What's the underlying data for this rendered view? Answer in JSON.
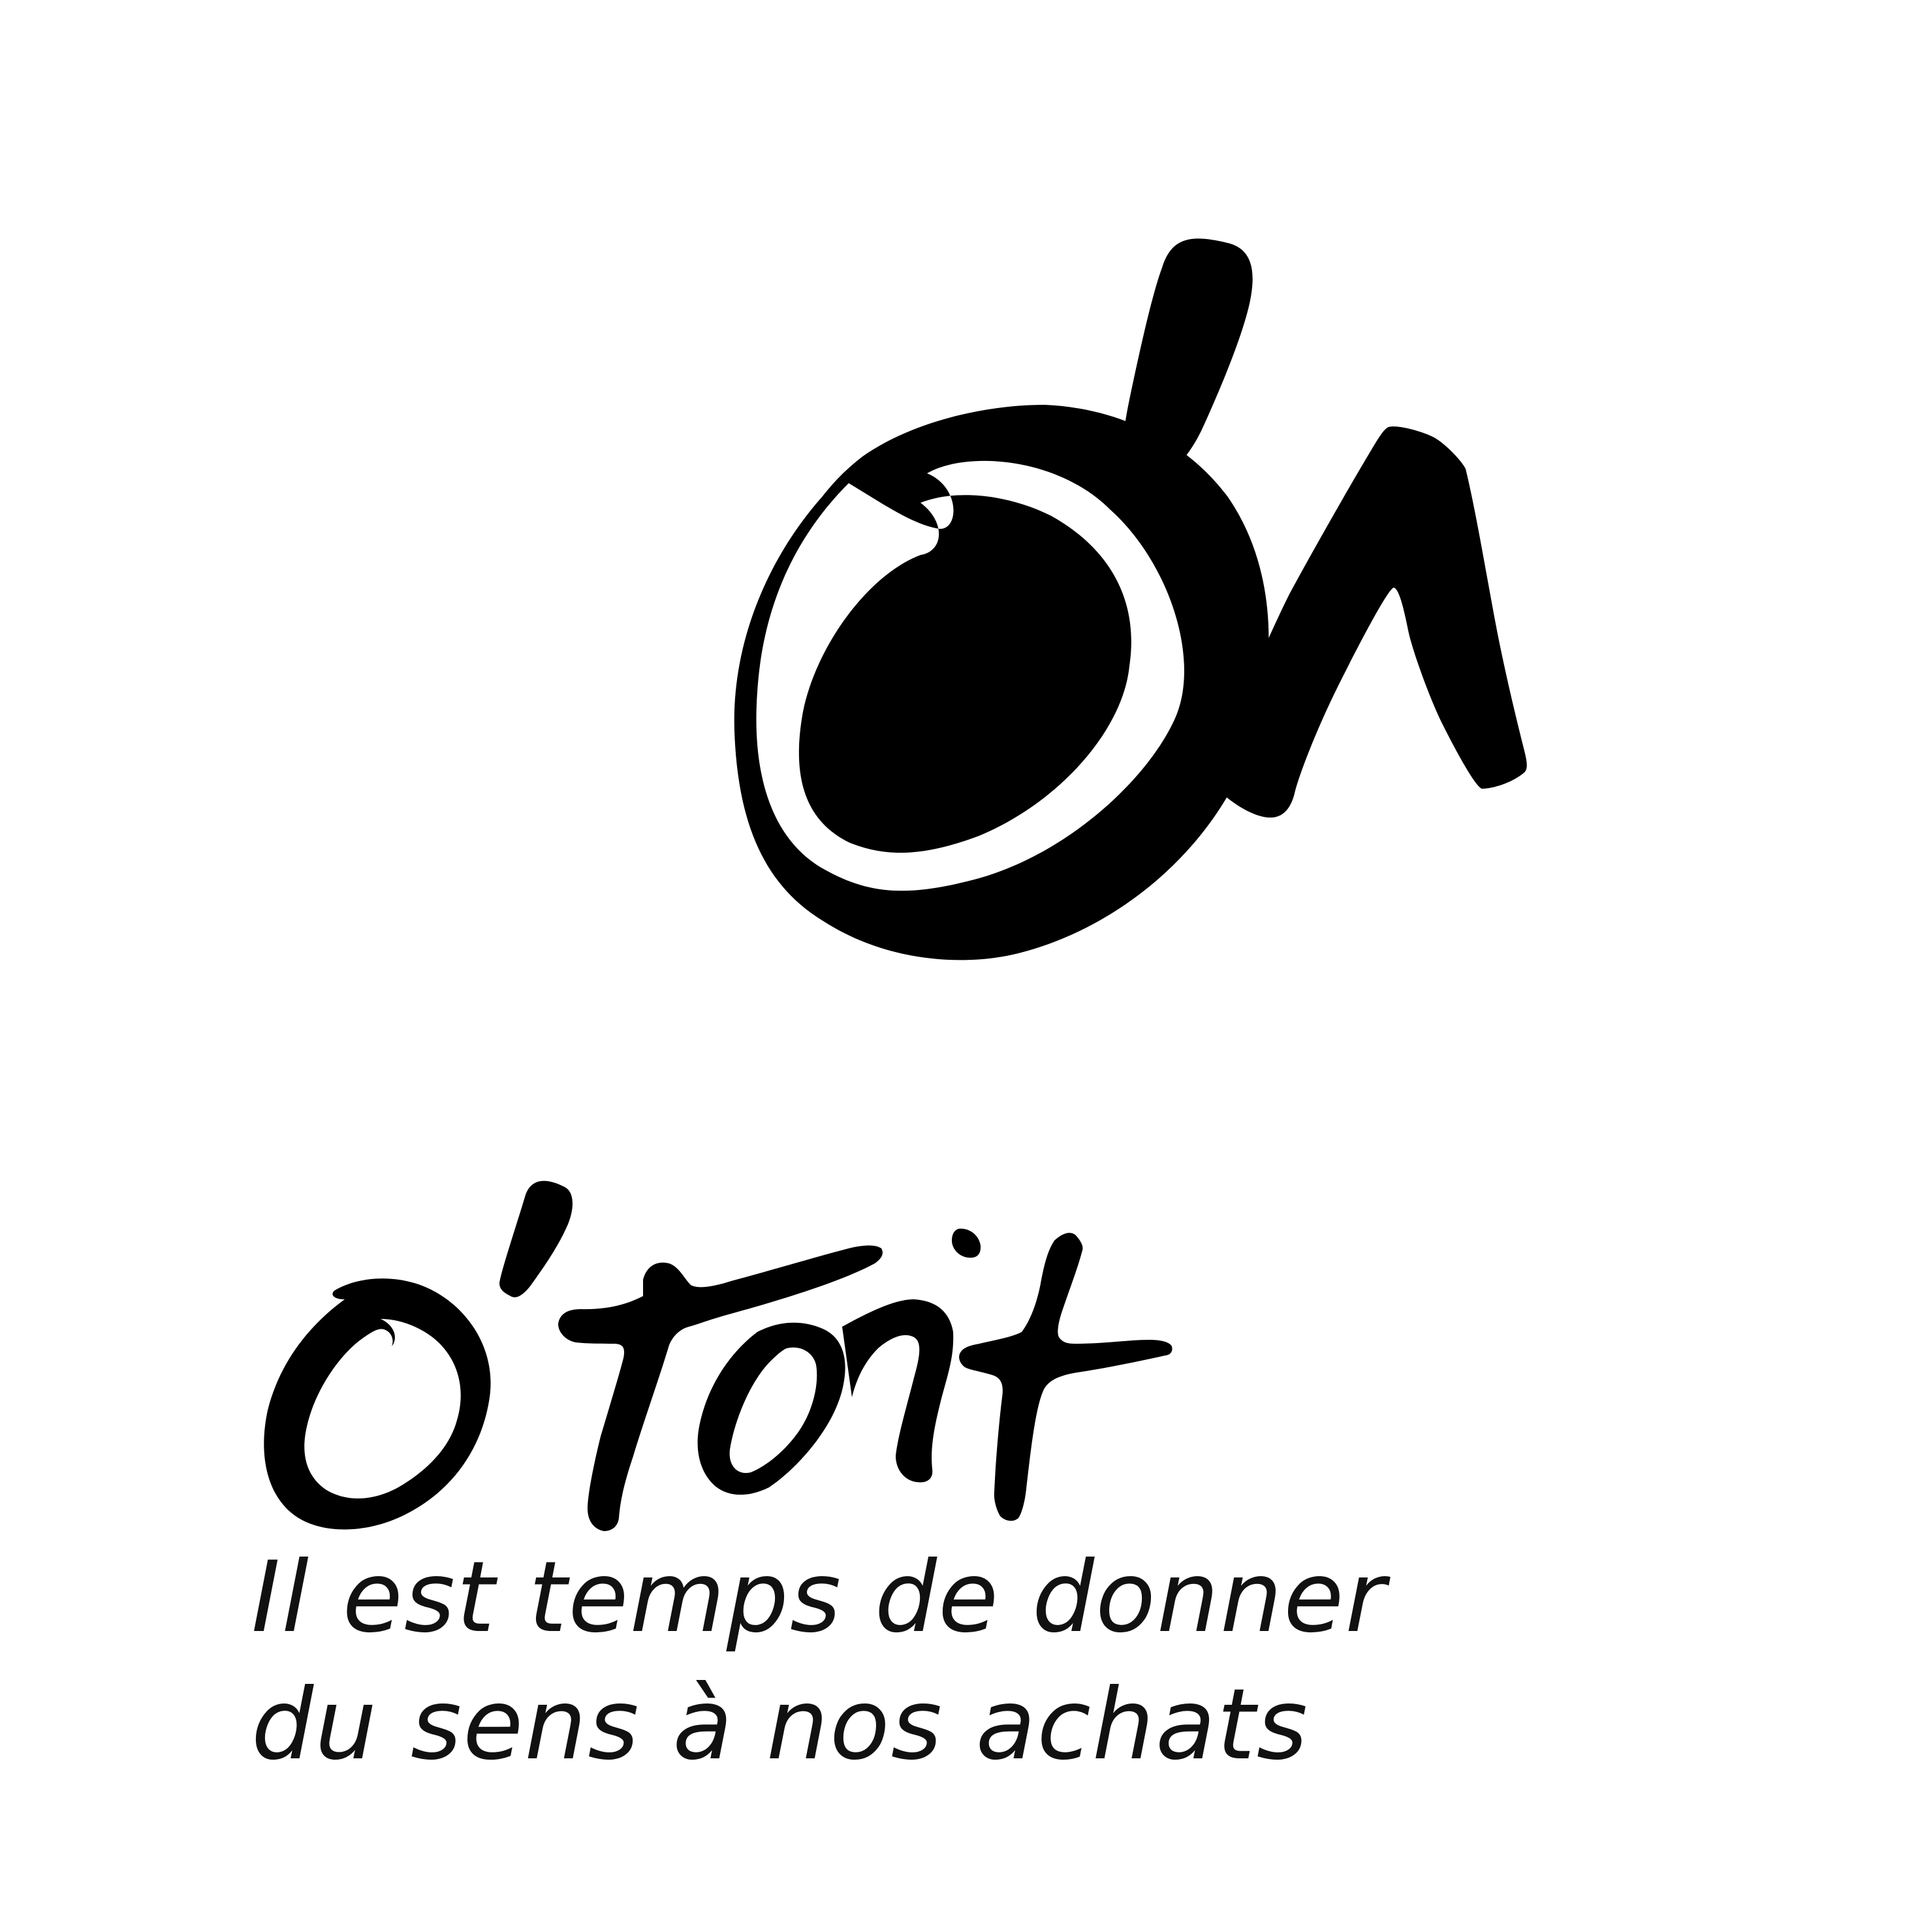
{
  "brand": {
    "name": "o'toit",
    "monogram": "o^",
    "tagline": {
      "line1": "Il est temps de donner",
      "line2": "du sens à nos achats"
    }
  },
  "colors": {
    "ink": "#000000",
    "background": "#ffffff",
    "text": "#111111"
  },
  "icons": [
    "logo-monogram-icon",
    "logo-wordmark-icon"
  ]
}
